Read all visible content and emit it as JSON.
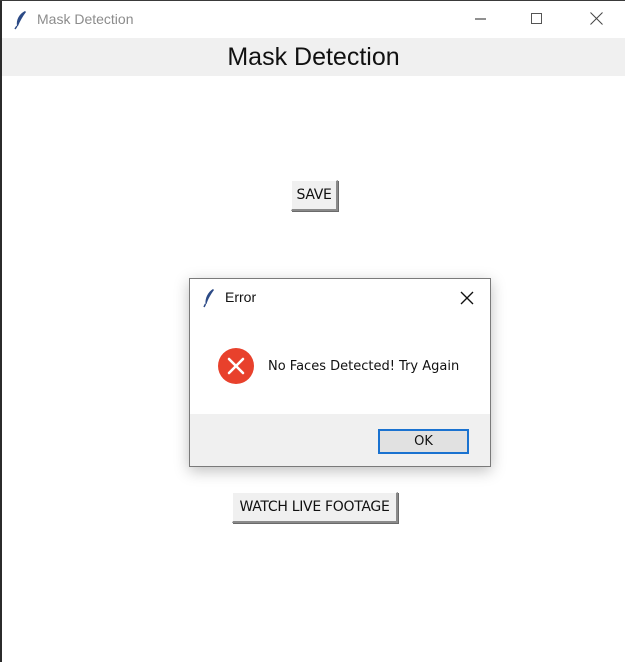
{
  "window": {
    "title": "Mask Detection",
    "icon": "feather-icon",
    "controls": [
      "minimize-icon",
      "maximize-icon",
      "close-icon"
    ]
  },
  "header": {
    "label": "Mask Detection"
  },
  "buttons": {
    "save_label": "SAVE",
    "live_label": "WATCH LIVE FOOTAGE"
  },
  "dialog": {
    "title": "Error",
    "message": "No Faces Detected! Try Again",
    "ok_label": "OK",
    "icon": "error-icon",
    "accent": "#1a72d0",
    "error_color": "#e8412c"
  }
}
